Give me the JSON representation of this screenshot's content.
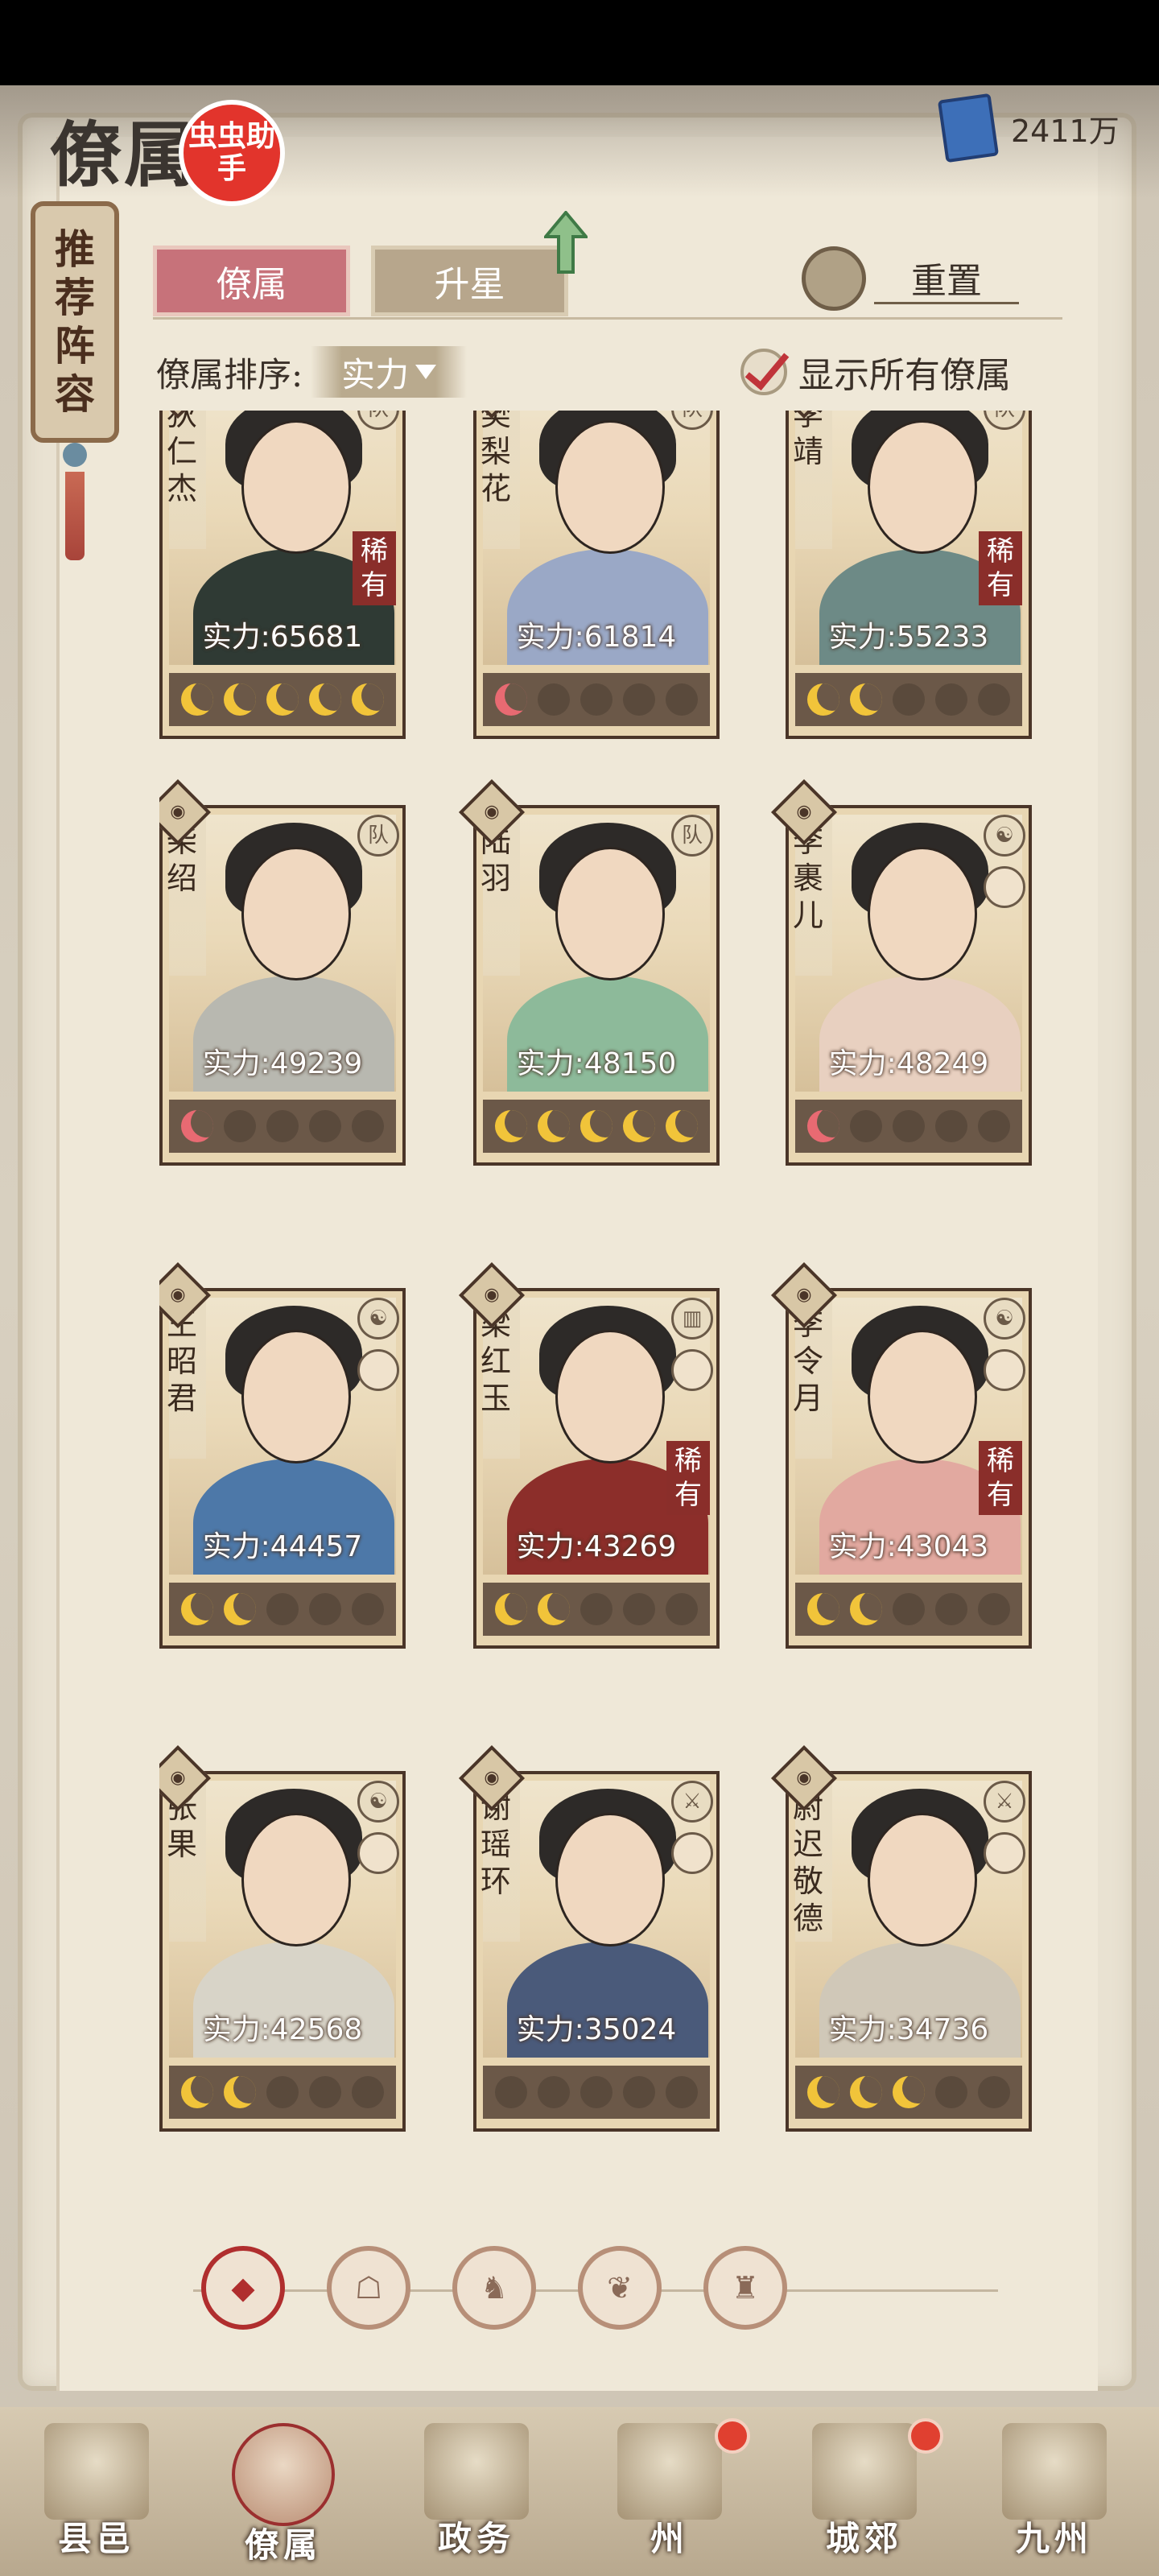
{
  "header": {
    "title": "僚属",
    "badge_text": "虫虫助手",
    "currency_value": "2411万"
  },
  "side_tab": {
    "label": "推荐阵容"
  },
  "tabs": [
    {
      "label": "僚属",
      "active": true
    },
    {
      "label": "升星",
      "active": false
    }
  ],
  "reset_label": "重置",
  "sort": {
    "label": "僚属排序:",
    "value": "实力"
  },
  "show_all": {
    "label": "显示所有僚属",
    "checked": true
  },
  "cards": [
    {
      "name": "狄仁杰",
      "power": "实力:65681",
      "rare": "稀有",
      "stars_total": 5,
      "stars_filled": 5,
      "star_color": "gold",
      "role_icon": "队"
    },
    {
      "name": "樊梨花",
      "power": "实力:61814",
      "rare": "",
      "stars_total": 5,
      "stars_filled": 1,
      "star_color": "pink",
      "role_icon": "队"
    },
    {
      "name": "李靖",
      "power": "实力:55233",
      "rare": "稀有",
      "stars_total": 5,
      "stars_filled": 2,
      "star_color": "gold",
      "role_icon": "队"
    },
    {
      "name": "柴绍",
      "power": "实力:49239",
      "rare": "",
      "stars_total": 5,
      "stars_filled": 1,
      "star_color": "pink",
      "role_icon": "队"
    },
    {
      "name": "陆羽",
      "power": "实力:48150",
      "rare": "",
      "stars_total": 5,
      "stars_filled": 5,
      "star_color": "gold",
      "role_icon": "队"
    },
    {
      "name": "李裹儿",
      "power": "实力:48249",
      "rare": "",
      "stars_total": 5,
      "stars_filled": 1,
      "star_color": "pink",
      "role_icon": "☯"
    },
    {
      "name": "王昭君",
      "power": "实力:44457",
      "rare": "",
      "stars_total": 5,
      "stars_filled": 2,
      "star_color": "gold",
      "role_icon": "☯"
    },
    {
      "name": "梁红玉",
      "power": "实力:43269",
      "rare": "稀有",
      "stars_total": 5,
      "stars_filled": 2,
      "star_color": "gold",
      "role_icon": "▥"
    },
    {
      "name": "李令月",
      "power": "实力:43043",
      "rare": "稀有",
      "stars_total": 5,
      "stars_filled": 2,
      "star_color": "gold",
      "role_icon": "☯"
    },
    {
      "name": "张果",
      "power": "实力:42568",
      "rare": "",
      "stars_total": 5,
      "stars_filled": 2,
      "star_color": "gold",
      "role_icon": "☯"
    },
    {
      "name": "谢瑶环",
      "power": "实力:35024",
      "rare": "",
      "stars_total": 5,
      "stars_filled": 0,
      "star_color": "gold",
      "role_icon": "⚔"
    },
    {
      "name": "尉迟敬德",
      "power": "实力:34736",
      "rare": "",
      "stars_total": 5,
      "stars_filled": 3,
      "star_color": "gold",
      "role_icon": "⚔"
    }
  ],
  "bottom_nav": [
    {
      "label": "县邑"
    },
    {
      "label": "僚属"
    },
    {
      "label": "政务"
    },
    {
      "label": "州"
    },
    {
      "label": "城郊"
    },
    {
      "label": "九州"
    }
  ]
}
